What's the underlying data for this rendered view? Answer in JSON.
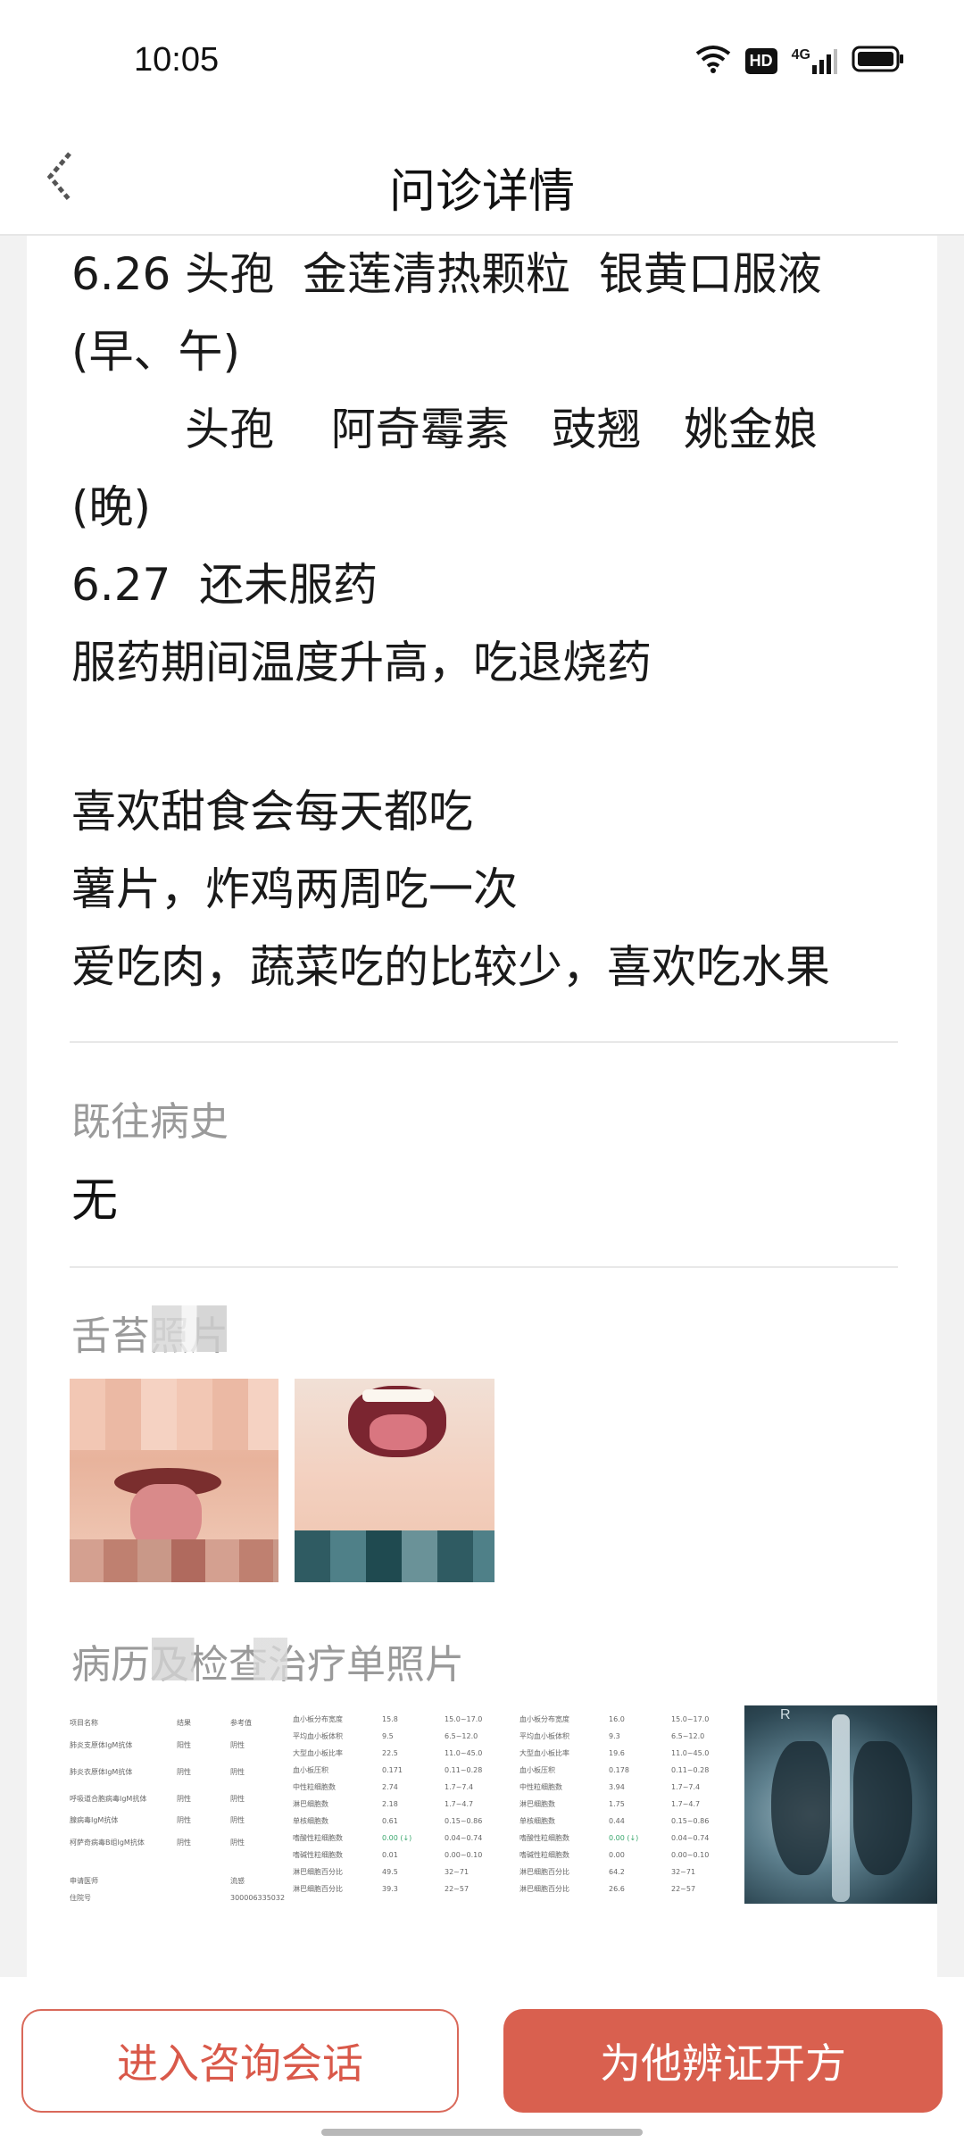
{
  "status_bar": {
    "time": "10:05",
    "hd_label": "HD",
    "network_label": "4G"
  },
  "header": {
    "title": "问诊详情"
  },
  "notes": {
    "lines": [
      "6.26 头孢  金莲清热颗粒  银黄口服液",
      "(早、午)",
      "        头孢    阿奇霉素   豉翘   姚金娘",
      "(晚)",
      "6.27  还未服药",
      "服药期间温度升高，吃退烧药",
      "",
      "喜欢甜食会每天都吃",
      "薯片，炸鸡两周吃一次",
      "爱吃肉，蔬菜吃的比较少，喜欢吃水果"
    ]
  },
  "past_history": {
    "label": "既往病史",
    "value": "无"
  },
  "tongue_photos": {
    "label": "舌苔照片"
  },
  "records": {
    "label": "病历及检查治疗单照片",
    "report1": {
      "rows": [
        [
          "项目名称",
          "结果",
          "参考值"
        ],
        [
          "肺炎支原体IgM抗体",
          "阳性",
          "阴性"
        ],
        [
          "肺炎衣原体IgM抗体",
          "阴性",
          "阴性"
        ],
        [
          "呼吸道合胞病毒IgM抗体",
          "阴性",
          "阴性"
        ],
        [
          "腺病毒IgM抗体",
          "阴性",
          "阴性"
        ],
        [
          "柯萨奇病毒B组IgM抗体",
          "阴性",
          "阴性"
        ],
        [
          "",
          "",
          ""
        ],
        [
          "申请医师",
          "",
          "流感"
        ],
        [
          "住院号",
          "",
          "300006335032"
        ]
      ]
    },
    "report2": {
      "rows": [
        [
          "血小板分布宽度",
          "15.8",
          "15.0~17.0"
        ],
        [
          "平均血小板体积",
          "9.5",
          "6.5~12.0"
        ],
        [
          "大型血小板比率",
          "22.5",
          "11.0~45.0"
        ],
        [
          "血小板压积",
          "0.171",
          "0.11~0.28"
        ],
        [
          "中性粒细胞数",
          "2.74",
          "1.7~7.4"
        ],
        [
          "淋巴细胞数",
          "2.18",
          "1.7~4.7"
        ],
        [
          "单核细胞数",
          "0.61",
          "0.15~0.86"
        ],
        [
          "嗜酸性粒细胞数",
          "0.00 (↓)",
          "0.04~0.74"
        ],
        [
          "嗜碱性粒细胞数",
          "0.01",
          "0.00~0.10"
        ],
        [
          "淋巴细胞百分比",
          "49.5",
          "32~71"
        ],
        [
          "淋巴细胞百分比",
          "39.3",
          "22~57"
        ]
      ]
    },
    "report3": {
      "rows": [
        [
          "血小板分布宽度",
          "16.0",
          "15.0~17.0"
        ],
        [
          "平均血小板体积",
          "9.3",
          "6.5~12.0"
        ],
        [
          "大型血小板比率",
          "19.6",
          "11.0~45.0"
        ],
        [
          "血小板压积",
          "0.178",
          "0.11~0.28"
        ],
        [
          "中性粒细胞数",
          "3.94",
          "1.7~7.4"
        ],
        [
          "淋巴细胞数",
          "1.75",
          "1.7~4.7"
        ],
        [
          "单核细胞数",
          "0.44",
          "0.15~0.86"
        ],
        [
          "嗜酸性粒细胞数",
          "0.00 (↓)",
          "0.04~0.74"
        ],
        [
          "嗜碱性粒细胞数",
          "0.00",
          "0.00~0.10"
        ],
        [
          "淋巴细胞百分比",
          "64.2",
          "32~71"
        ],
        [
          "淋巴细胞百分比",
          "26.6",
          "22~57"
        ]
      ]
    },
    "xray_marker": "R"
  },
  "actions": {
    "consult_label": "进入咨询会话",
    "prescribe_label": "为他辨证开方"
  },
  "colors": {
    "accent": "#d9604f",
    "accent_text": "#d9594a"
  }
}
